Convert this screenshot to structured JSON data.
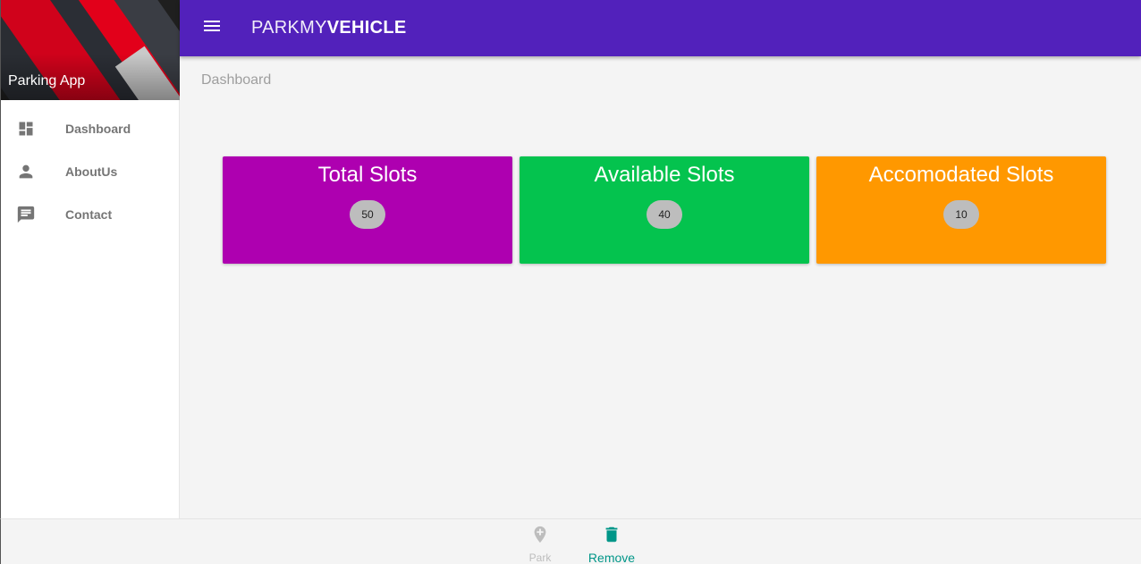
{
  "app": {
    "sidebar_title": "Parking App",
    "brand_light": "PARKMY",
    "brand_bold": "VEHICLE"
  },
  "sidebar": {
    "items": [
      {
        "label": "Dashboard",
        "icon": "dashboard-icon"
      },
      {
        "label": "AboutUs",
        "icon": "person-icon"
      },
      {
        "label": "Contact",
        "icon": "message-icon"
      }
    ]
  },
  "breadcrumb": "Dashboard",
  "cards": [
    {
      "title": "Total Slots",
      "count": "50",
      "color": "#ae00b0"
    },
    {
      "title": "Available Slots",
      "count": "40",
      "color": "#04c34e"
    },
    {
      "title": "Accomodated Slots",
      "count": "10",
      "color": "#ff9800"
    }
  ],
  "bottom_nav": {
    "park_label": "Park",
    "remove_label": "Remove",
    "active_color": "#009688"
  },
  "colors": {
    "topbar": "#5221bb"
  }
}
